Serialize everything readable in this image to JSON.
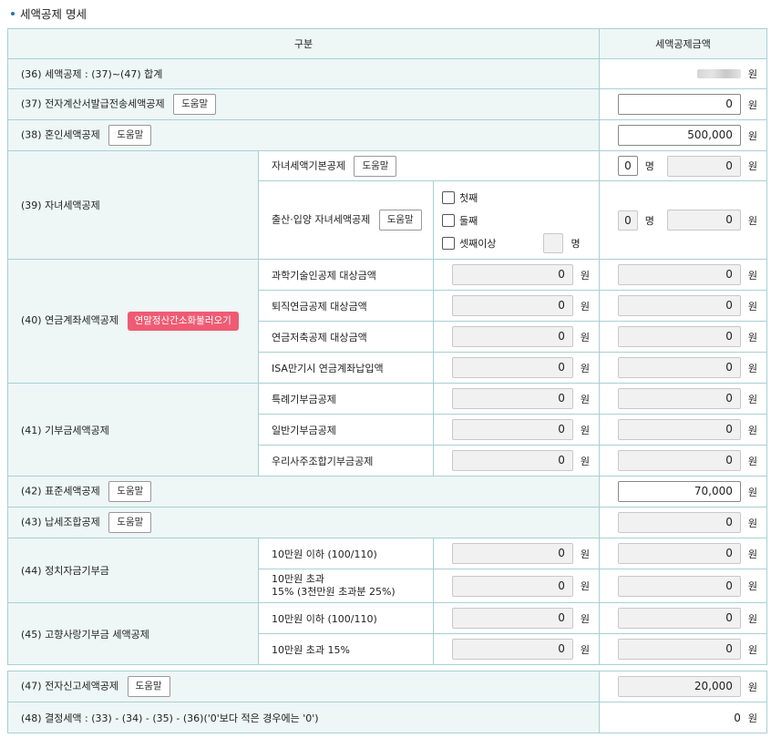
{
  "section_title": "세액공제 명세",
  "header": {
    "col1": "구분",
    "col2": "세액공제금액"
  },
  "unit_won": "원",
  "unit_person": "명",
  "help_label": "도움말",
  "rows": {
    "r36": {
      "label": "(36) 세액공제 : (37)~(47) 합계",
      "value": ""
    },
    "r37": {
      "label": "(37) 전자계산서발급전송세액공제",
      "value": "0"
    },
    "r38": {
      "label": "(38) 혼인세액공제",
      "value": "500,000"
    },
    "r39": {
      "label": "(39) 자녀세액공제",
      "basic_label": "자녀세액기본공제",
      "basic_count": "0",
      "basic_value": "0",
      "birth_label": "출산·입양 자녀세액공제",
      "opt1": "첫째",
      "opt2": "둘째",
      "opt3": "셋째이상",
      "birth_count": "0",
      "birth_value": "0"
    },
    "r40": {
      "label": "(40) 연금계좌세액공제",
      "load_button": "연말정산간소화불러오기",
      "items": [
        {
          "label": "과학기술인공제 대상금액",
          "base": "0",
          "value": "0"
        },
        {
          "label": "퇴직연금공제 대상금액",
          "base": "0",
          "value": "0"
        },
        {
          "label": "연금저축공제 대상금액",
          "base": "0",
          "value": "0"
        },
        {
          "label": "ISA만기시 연금계좌납입액",
          "base": "0",
          "value": "0"
        }
      ]
    },
    "r41": {
      "label": "(41) 기부금세액공제",
      "items": [
        {
          "label": "특례기부금공제",
          "base": "0",
          "value": "0"
        },
        {
          "label": "일반기부금공제",
          "base": "0",
          "value": "0"
        },
        {
          "label": "우리사주조합기부금공제",
          "base": "0",
          "value": "0"
        }
      ]
    },
    "r42": {
      "label": "(42) 표준세액공제",
      "value": "70,000"
    },
    "r43": {
      "label": "(43) 납세조합공제",
      "value": "0"
    },
    "r44": {
      "label": "(44) 정치자금기부금",
      "items": [
        {
          "label": "10만원 이하 (100/110)",
          "base": "0",
          "value": "0"
        },
        {
          "label": "10만원 초과",
          "label2": "15% (3천만원 초과분 25%)",
          "base": "0",
          "value": "0"
        }
      ]
    },
    "r45": {
      "label": "(45) 고향사랑기부금 세액공제",
      "items": [
        {
          "label": "10만원 이하 (100/110)",
          "base": "0",
          "value": "0"
        },
        {
          "label": "10만원 초과 15%",
          "base": "0",
          "value": "0"
        }
      ]
    },
    "r47": {
      "label": "(47) 전자신고세액공제",
      "value": "20,000"
    },
    "r48": {
      "label": "(48) 결정세액 : (33) - (34) - (35) - (36)('0'보다 적은 경우에는 '0')",
      "value": "0"
    }
  }
}
